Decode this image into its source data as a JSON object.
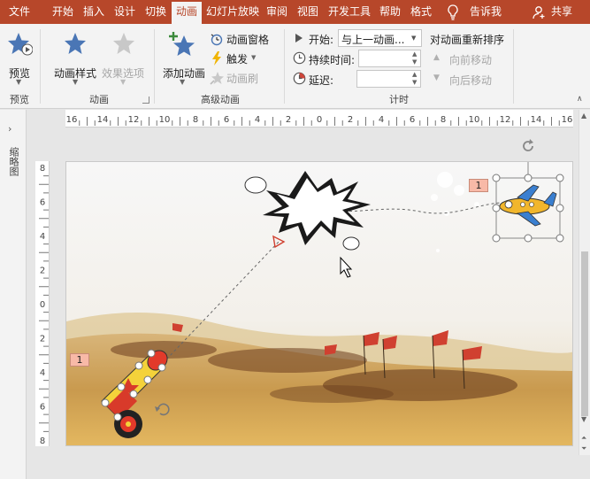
{
  "tabs": [
    {
      "label": "文件",
      "active": false
    },
    {
      "label": "开始",
      "active": false
    },
    {
      "label": "插入",
      "active": false
    },
    {
      "label": "设计",
      "active": false
    },
    {
      "label": "切换",
      "active": false
    },
    {
      "label": "动画",
      "active": true
    },
    {
      "label": "幻灯片放映",
      "active": false
    },
    {
      "label": "审阅",
      "active": false
    },
    {
      "label": "视图",
      "active": false
    },
    {
      "label": "开发工具",
      "active": false
    },
    {
      "label": "帮助",
      "active": false
    },
    {
      "label": "格式",
      "active": false
    }
  ],
  "tellme": "告诉我",
  "share": "共享",
  "groups": {
    "preview": {
      "label": "预览",
      "button": "预览"
    },
    "animation": {
      "label": "动画",
      "styles": "动画样式",
      "effects": "效果选项"
    },
    "advanced": {
      "label": "高级动画",
      "add": "添加动画",
      "pane": "动画窗格",
      "trigger": "触发",
      "painter": "动画刷"
    },
    "timing": {
      "label": "计时",
      "start_label": "开始:",
      "start_value": "与上一动画...",
      "duration_label": "持续时间:",
      "delay_label": "延迟:",
      "reorder": "对动画重新排序",
      "forward": "向前移动",
      "backward": "向后移动"
    }
  },
  "thumbnails_label": "缩略图",
  "hruler_labels": [
    "16",
    "14",
    "12",
    "10",
    "8",
    "6",
    "4",
    "2",
    "0",
    "2",
    "4",
    "6",
    "8",
    "10",
    "12",
    "14",
    "16"
  ],
  "vruler_labels": [
    "8",
    "6",
    "4",
    "2",
    "0",
    "2",
    "4",
    "6",
    "8"
  ],
  "slide": {
    "tag_plane": "1",
    "tag_cannon": "1"
  },
  "colors": {
    "accent": "#b7472a",
    "star": "#4a76b5",
    "tag": "#f8b9a7"
  }
}
